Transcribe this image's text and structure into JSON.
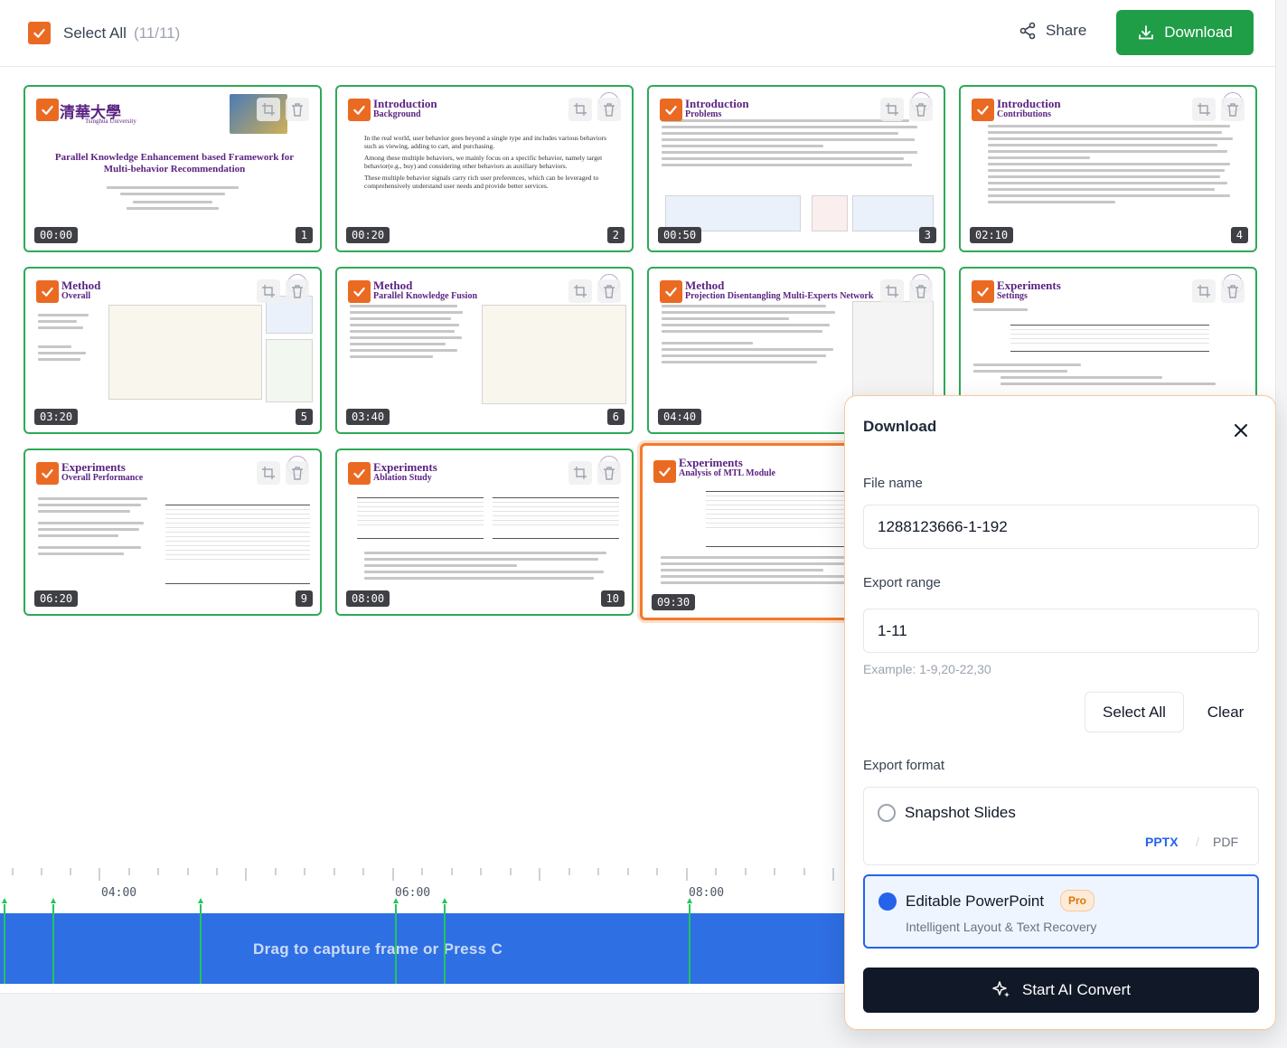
{
  "toolbar": {
    "select_all_label": "Select All",
    "select_all_count": "(11/11)",
    "share_label": "Share",
    "download_label": "Download"
  },
  "slides": [
    {
      "title": "",
      "subtitle": "",
      "time": "00:00",
      "num": "1",
      "main_title": "Parallel Knowledge Enhancement based Framework for Multi-behavior Recommendation",
      "logo_text": "清華大學",
      "logo_sub": "Tsinghua University"
    },
    {
      "title": "Introduction",
      "subtitle": "Background",
      "time": "00:20",
      "num": "2",
      "bullets": [
        "In the real world, user behavior goes beyond a single type and includes various behaviors such as viewing, adding to cart, and purchasing.",
        "Among these multiple behaviors, we mainly focus on a specific behavior, namely target behavior(e.g., buy) and considering other behaviors as auxiliary behaviors.",
        "These multiple behavior signals carry rich user preferences, which can be leveraged to comprehensively understand user needs and provide better services."
      ]
    },
    {
      "title": "Introduction",
      "subtitle": "Problems",
      "time": "00:50",
      "num": "3"
    },
    {
      "title": "Introduction",
      "subtitle": "Contributions",
      "time": "02:10",
      "num": "4"
    },
    {
      "title": "Method",
      "subtitle": "Overall",
      "time": "03:20",
      "num": "5"
    },
    {
      "title": "Method",
      "subtitle": "Parallel Knowledge Fusion",
      "time": "03:40",
      "num": "6"
    },
    {
      "title": "Method",
      "subtitle": "Projection Disentangling Multi-Experts Network",
      "time": "04:40",
      "num": "7"
    },
    {
      "title": "Experiments",
      "subtitle": "Settings",
      "time": "",
      "num": ""
    },
    {
      "title": "Experiments",
      "subtitle": "Overall Performance",
      "time": "06:20",
      "num": "9"
    },
    {
      "title": "Experiments",
      "subtitle": "Ablation Study",
      "time": "08:00",
      "num": "10"
    },
    {
      "title": "Experiments",
      "subtitle": "Analysis of MTL Module",
      "time": "09:30",
      "num": ""
    }
  ],
  "timeline": {
    "labels": [
      "04:00",
      "06:00",
      "08:00"
    ],
    "hint": "Drag to capture frame or Press C"
  },
  "panel": {
    "title": "Download",
    "file_name_label": "File name",
    "file_name_value": "1288123666-1-192",
    "export_range_label": "Export range",
    "export_range_value": "1-11",
    "export_range_help": "Example: 1-9,20-22,30",
    "select_all_label": "Select All",
    "clear_label": "Clear",
    "export_format_label": "Export format",
    "option1_title": "Snapshot Slides",
    "option1_pptx": "PPTX",
    "option1_sep": "/",
    "option1_pdf": "PDF",
    "option2_title": "Editable PowerPoint",
    "option2_badge": "Pro",
    "option2_desc": "Intelligent Layout & Text Recovery",
    "convert_label": "Start AI Convert"
  },
  "colors": {
    "accent_orange": "#ea6a22",
    "download_green": "#1f9d47",
    "selected_blue": "#2563eb",
    "timeline_blue": "#2f6fe4"
  }
}
